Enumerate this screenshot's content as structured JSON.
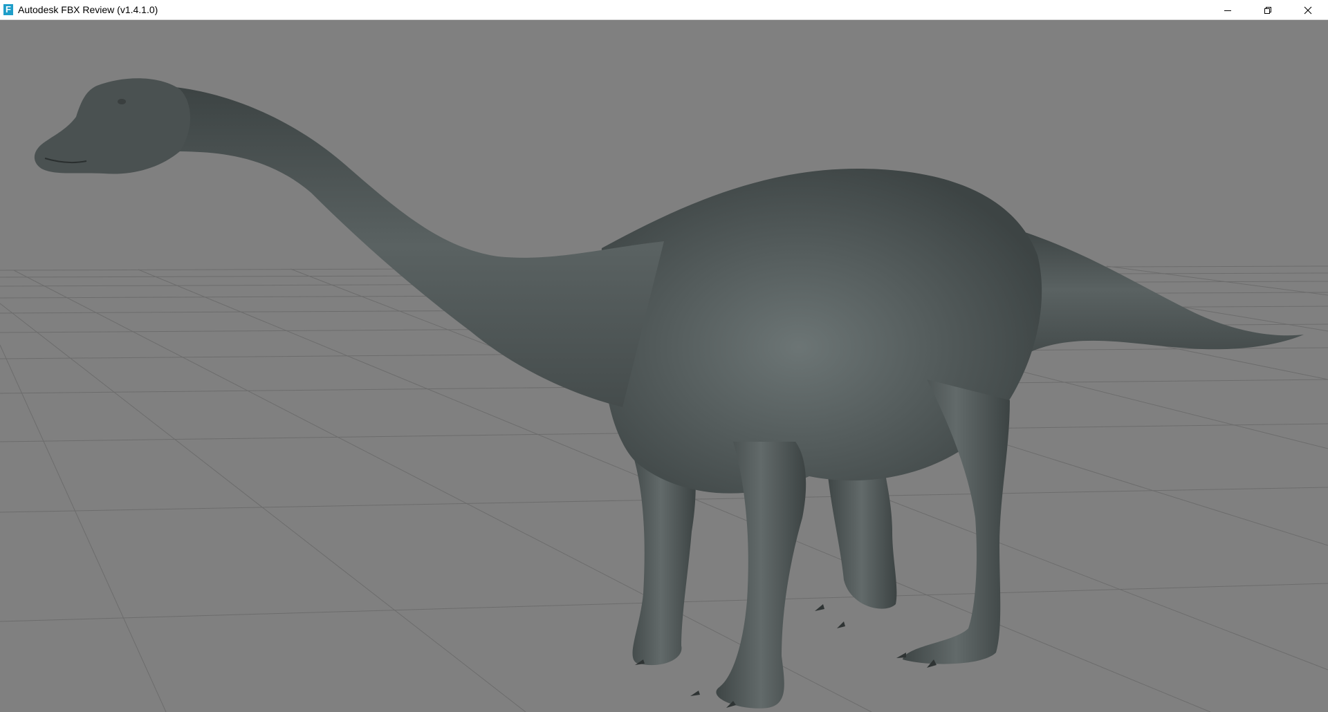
{
  "window": {
    "title": "Autodesk FBX Review (v1.4.1.0)",
    "app_icon_letter": "F",
    "app_icon_color": "#1f9ec9",
    "controls": [
      "minimize-icon",
      "restore-icon",
      "close-icon"
    ]
  },
  "viewport": {
    "background_color": "#808080",
    "grid_color": "#6e6e6e",
    "model": {
      "subject": "sauropod-dinosaur",
      "skin_color": "#4f5656"
    }
  }
}
